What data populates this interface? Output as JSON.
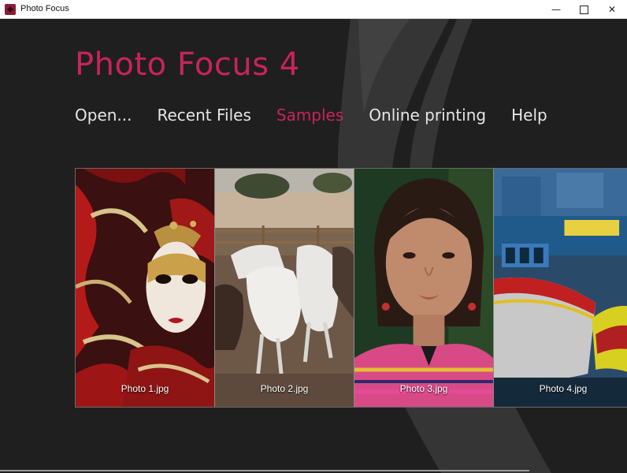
{
  "window": {
    "title": "Photo Focus",
    "icon": "app-logo-icon"
  },
  "window_controls": {
    "minimize": "—",
    "close": "✕"
  },
  "app": {
    "heading": "Photo Focus 4"
  },
  "nav": {
    "items": [
      {
        "label": "Open..."
      },
      {
        "label": "Recent Files"
      },
      {
        "label": "Samples",
        "active": true
      },
      {
        "label": "Online printing"
      },
      {
        "label": "Help"
      }
    ]
  },
  "gallery": {
    "photos": [
      {
        "caption": "Photo 1.jpg",
        "subject": "carnival mask"
      },
      {
        "caption": "Photo 2.jpg",
        "subject": "white horses"
      },
      {
        "caption": "Photo 3.jpg",
        "subject": "girl portrait"
      },
      {
        "caption": "Photo 4.jpg",
        "subject": "fishing boats"
      }
    ]
  },
  "colors": {
    "accent": "#c7245a",
    "background": "#1f1f20",
    "text": "#e6e6e6"
  }
}
